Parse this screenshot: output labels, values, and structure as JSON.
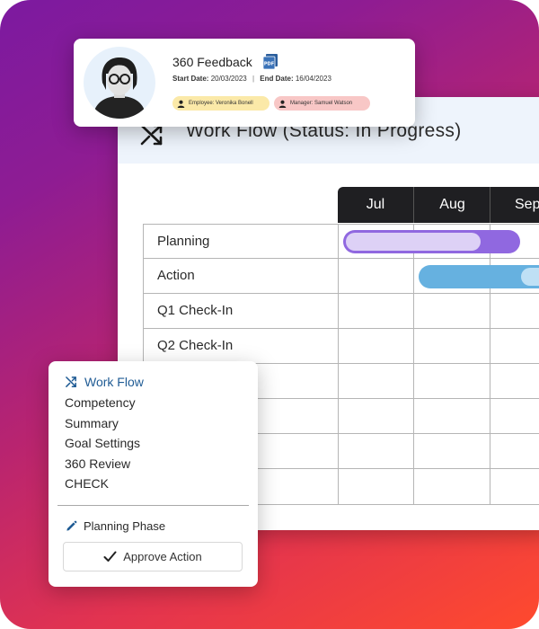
{
  "feedback_card": {
    "title": "360 Feedback",
    "start_label": "Start Date:",
    "start_date": "20/03/2023",
    "end_label": "End Date:",
    "end_date": "16/04/2023",
    "employee_chip": "Employee: Veronika Bonell",
    "manager_chip": "Manager: Samuel Watson",
    "pdf_icon": "pdf-icon",
    "avatar_icon": "person-with-glasses-avatar"
  },
  "workflow": {
    "title": "Work Flow (Status: In Progress)",
    "header_icon": "shuffle-icon",
    "months": [
      "Jul",
      "Aug",
      "Sep"
    ],
    "rows": [
      "Planning",
      "Action",
      "Q1 Check-In",
      "Q2 Check-In",
      "",
      "",
      "",
      ""
    ],
    "bar_colors": {
      "planning": "#9068e0",
      "planning_fill": "#ddd1f6",
      "action": "#66b1e0",
      "action_fill": "#bfe0f5"
    }
  },
  "menu": {
    "items": [
      "Work Flow",
      "Competency",
      "Summary",
      "Goal Settings",
      "360 Review",
      "CHECK"
    ],
    "active_icon": "shuffle-icon",
    "phase_label": "Planning Phase",
    "phase_icon": "pencil-icon",
    "approve_label": "Approve Action",
    "approve_icon": "check-icon"
  },
  "colors": {
    "accent": "#1f5b94",
    "gradient_start": "#7c1aa0",
    "gradient_end": "#ff4a2d",
    "month_header": "#1f1f22"
  }
}
